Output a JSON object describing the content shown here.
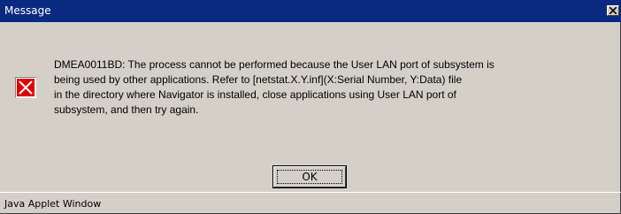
{
  "window": {
    "title": "Message",
    "close_icon": "close-icon"
  },
  "dialog": {
    "icon": "error-icon",
    "message_lines": [
      "DMEA0011BD: The process cannot be performed because the User LAN port of subsystem is",
      "being used by other applications. Refer to [netstat.X.Y.inf](X:Serial Number, Y:Data) file",
      "in the directory where Navigator is installed, close applications using User LAN port of",
      "subsystem, and then try again."
    ],
    "ok_label": "OK"
  },
  "status": {
    "text": "Java Applet Window"
  },
  "colors": {
    "titlebar": "#0a2a82",
    "window_bg": "#d4d0c8",
    "error_red": "#e00000"
  }
}
